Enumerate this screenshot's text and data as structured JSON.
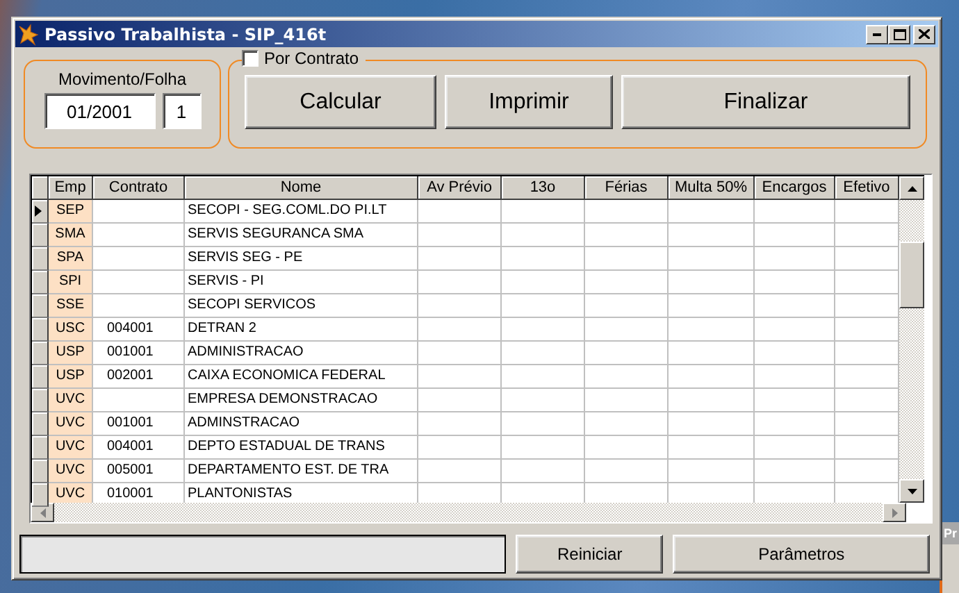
{
  "window": {
    "title": "Passivo Trabalhista - SIP_416t"
  },
  "movimento": {
    "label": "Movimento/Folha",
    "period": "01/2001",
    "folha": "1"
  },
  "por_contrato": {
    "label": "Por Contrato",
    "checked": false
  },
  "actions": [
    "Calcular",
    "Imprimir",
    "Finalizar"
  ],
  "table": {
    "columns": [
      "Emp",
      "Contrato",
      "Nome",
      "Av Prévio",
      "13o",
      "Férias",
      "Multa 50%",
      "Encargos",
      "Efetivo"
    ],
    "rows": [
      {
        "emp": "SEP",
        "nome": "SECOPI - SEG.COML.DO PI.LT",
        "current": true
      },
      {
        "emp": "SMA",
        "nome": "SERVIS SEGURANCA SMA",
        "current": false
      },
      {
        "emp": "SPA",
        "nome": "SERVIS SEG - PE",
        "current": false
      },
      {
        "emp": "SPI",
        "nome": "SERVIS - PI",
        "current": false
      },
      {
        "emp": "SSE",
        "nome": "SECOPI SERVICOS",
        "current": false
      },
      {
        "emp": "USC",
        "contrato": "004001",
        "nome": "DETRAN 2",
        "current": false
      },
      {
        "emp": "USP",
        "contrato": "001001",
        "nome": "ADMINISTRACAO",
        "current": false
      },
      {
        "emp": "USP",
        "contrato": "002001",
        "nome": "CAIXA ECONOMICA FEDERAL",
        "current": false
      },
      {
        "emp": "UVC",
        "nome": "EMPRESA DEMONSTRACAO",
        "current": false
      },
      {
        "emp": "UVC",
        "contrato": "001001",
        "nome": "ADMINSTRACAO",
        "current": false
      },
      {
        "emp": "UVC",
        "contrato": "004001",
        "nome": "DEPTO ESTADUAL DE TRANS",
        "current": false
      },
      {
        "emp": "UVC",
        "contrato": "005001",
        "nome": "DEPARTAMENTO EST. DE TRA",
        "current": false
      },
      {
        "emp": "UVC",
        "contrato": "010001",
        "nome": "PLANTONISTAS",
        "current": false
      }
    ]
  },
  "bottom_buttons": [
    "Reiniciar",
    "Parâmetros"
  ],
  "background_window": {
    "title": "Pr"
  }
}
